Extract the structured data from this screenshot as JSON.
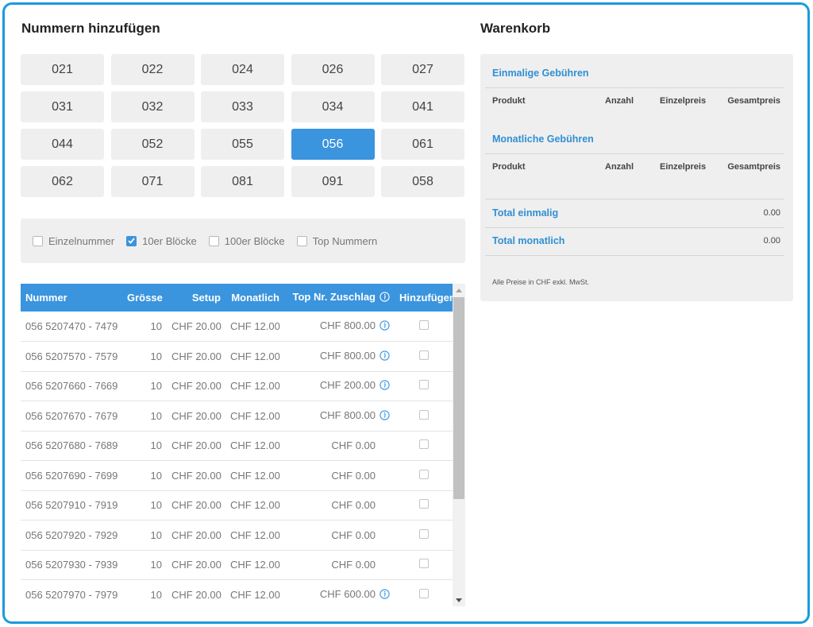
{
  "left_title": "Nummern hinzufügen",
  "right_title": "Warenkorb",
  "area_codes": [
    {
      "label": "021",
      "active": false
    },
    {
      "label": "022",
      "active": false
    },
    {
      "label": "024",
      "active": false
    },
    {
      "label": "026",
      "active": false
    },
    {
      "label": "027",
      "active": false
    },
    {
      "label": "031",
      "active": false
    },
    {
      "label": "032",
      "active": false
    },
    {
      "label": "033",
      "active": false
    },
    {
      "label": "034",
      "active": false
    },
    {
      "label": "041",
      "active": false
    },
    {
      "label": "044",
      "active": false
    },
    {
      "label": "052",
      "active": false
    },
    {
      "label": "055",
      "active": false
    },
    {
      "label": "056",
      "active": true
    },
    {
      "label": "061",
      "active": false
    },
    {
      "label": "062",
      "active": false
    },
    {
      "label": "071",
      "active": false
    },
    {
      "label": "081",
      "active": false
    },
    {
      "label": "091",
      "active": false
    },
    {
      "label": "058",
      "active": false
    }
  ],
  "filters": [
    {
      "label": "Einzelnummer",
      "checked": false
    },
    {
      "label": "10er Blöcke",
      "checked": true
    },
    {
      "label": "100er Blöcke",
      "checked": false
    },
    {
      "label": "Top Nummern",
      "checked": false
    }
  ],
  "table": {
    "headers": {
      "nummer": "Nummer",
      "groesse": "Grösse",
      "setup": "Setup",
      "monatlich": "Monatlich",
      "zuschlag": "Top Nr. Zuschlag",
      "hinzufuegen": "Hinzufügen"
    },
    "rows": [
      {
        "nummer": "056 5207470 - 7479",
        "groesse": "10",
        "setup": "CHF 20.00",
        "monatlich": "CHF 12.00",
        "zuschlag": "CHF 800.00",
        "info": true
      },
      {
        "nummer": "056 5207570 - 7579",
        "groesse": "10",
        "setup": "CHF 20.00",
        "monatlich": "CHF 12.00",
        "zuschlag": "CHF 800.00",
        "info": true
      },
      {
        "nummer": "056 5207660 - 7669",
        "groesse": "10",
        "setup": "CHF 20.00",
        "monatlich": "CHF 12.00",
        "zuschlag": "CHF 200.00",
        "info": true
      },
      {
        "nummer": "056 5207670 - 7679",
        "groesse": "10",
        "setup": "CHF 20.00",
        "monatlich": "CHF 12.00",
        "zuschlag": "CHF 800.00",
        "info": true
      },
      {
        "nummer": "056 5207680 - 7689",
        "groesse": "10",
        "setup": "CHF 20.00",
        "monatlich": "CHF 12.00",
        "zuschlag": "CHF 0.00",
        "info": false
      },
      {
        "nummer": "056 5207690 - 7699",
        "groesse": "10",
        "setup": "CHF 20.00",
        "monatlich": "CHF 12.00",
        "zuschlag": "CHF 0.00",
        "info": false
      },
      {
        "nummer": "056 5207910 - 7919",
        "groesse": "10",
        "setup": "CHF 20.00",
        "monatlich": "CHF 12.00",
        "zuschlag": "CHF 0.00",
        "info": false
      },
      {
        "nummer": "056 5207920 - 7929",
        "groesse": "10",
        "setup": "CHF 20.00",
        "monatlich": "CHF 12.00",
        "zuschlag": "CHF 0.00",
        "info": false
      },
      {
        "nummer": "056 5207930 - 7939",
        "groesse": "10",
        "setup": "CHF 20.00",
        "monatlich": "CHF 12.00",
        "zuschlag": "CHF 0.00",
        "info": false
      },
      {
        "nummer": "056 5207970 - 7979",
        "groesse": "10",
        "setup": "CHF 20.00",
        "monatlich": "CHF 12.00",
        "zuschlag": "CHF 600.00",
        "info": true
      }
    ]
  },
  "cart": {
    "one_time_title": "Einmalige Gebühren",
    "monthly_title": "Monatliche Gebühren",
    "col_produkt": "Produkt",
    "col_anzahl": "Anzahl",
    "col_einzelpreis": "Einzelpreis",
    "col_gesamtpreis": "Gesamtpreis",
    "total_one_time_label": "Total einmalig",
    "total_one_time_value": "0.00",
    "total_monthly_label": "Total monatlich",
    "total_monthly_value": "0.00",
    "note": "Alle Preise in CHF exkl. MwSt."
  },
  "colors": {
    "accent": "#3a94de",
    "frame_border": "#1a9bdc",
    "cart_link": "#2f8fd4",
    "panel_bg": "#efefef"
  }
}
